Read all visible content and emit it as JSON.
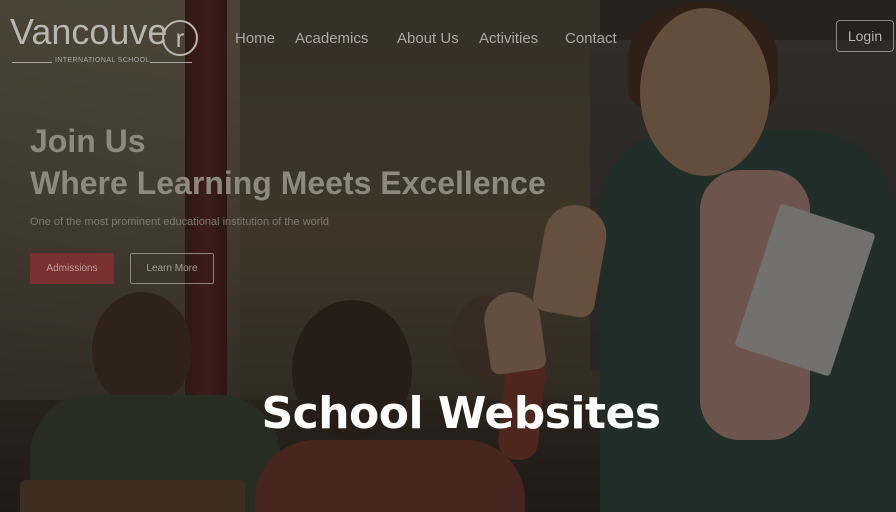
{
  "logo": {
    "wordmark": "Vancouve",
    "badge_letter": "r",
    "tagline": "INTERNATIONAL SCHOOL"
  },
  "nav": {
    "items": [
      {
        "label": "Home"
      },
      {
        "label": "Academics"
      },
      {
        "label": "About Us"
      },
      {
        "label": "Activities"
      },
      {
        "label": "Contact"
      }
    ],
    "login_label": "Login"
  },
  "hero": {
    "title_line1": "Join Us",
    "title_line2": "Where Learning Meets Excellence",
    "subtitle": "One of the most prominent educational institution of the world",
    "primary_button": "Admissions",
    "secondary_button": "Learn More"
  },
  "caption": "School Websites",
  "colors": {
    "accent": "#7a2f30",
    "overlay": "#12100e",
    "caption_text": "#ffffff"
  }
}
